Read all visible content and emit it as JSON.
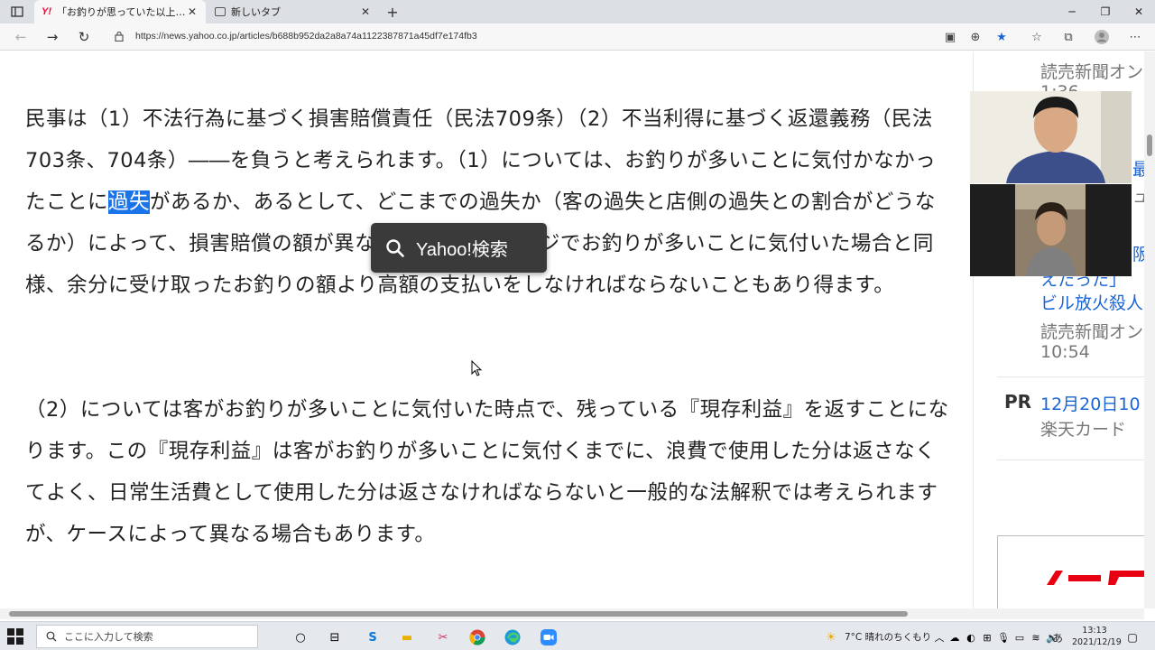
{
  "tabs": [
    {
      "label": "「お釣りが思っていた以上に多い」時",
      "favicon": "yahoo-icon",
      "active": true
    },
    {
      "label": "新しいタブ",
      "favicon": "page-icon",
      "active": false
    }
  ],
  "address_bar": {
    "url": "https://news.yahoo.co.jp/articles/b688b952da2a8a74a1122387871a45df7e174fb3"
  },
  "article": {
    "para1_before": "民事は（1）不法行為に基づく損害賠償責任（民法709条）（2）不当利得に基づく返還義務（民法703条、704条）――を負うと考えられます。（1）については、お釣りが多いことに気付かなかったことに",
    "para1_highlight": "過失",
    "para1_after": "があるか、あるとして、どこまでの過失か（客の過失と店側の過失との割合がどうなるか）によって、損害賠償の額が異なります。また、レジでお釣りが多いことに気付いた場合と同様、余分に受け取ったお釣りの額より高額の支払いをしなければならないこともあり得ます。",
    "para2": "（2）については客がお釣りが多いことに気付いた時点で、残っている『現存利益』を返すことになります。この『現存利益』は客がお釣りが多いことに気付くまでに、浪費で使用した分は返さなくてよく、日常生活費として使用した分は返さなければならないと一般的な法解釈では考えられますが、ケースによって異なる場合もあります。"
  },
  "popup": {
    "label": "Yahoo!検索"
  },
  "sidebar": {
    "item1_source": "読売新聞オン",
    "item1_time": "1:36",
    "item2_frag_a": "最",
    "item2_frag_b": "ュ",
    "item3_frag_a": "阪",
    "item3_line1": "えたった」",
    "item3_line2": "ビル放火殺人",
    "item3_source": "読売新聞オン",
    "item3_time": "10:54",
    "pr_label": "PR",
    "pr_title": "12月20日10",
    "pr_source": "楽天カード"
  },
  "taskbar": {
    "search_placeholder": "ここに入力して検索",
    "weather": "7°C  晴れのちくもり",
    "ime": "あ",
    "time": "13:13",
    "date": "2021/12/19"
  }
}
